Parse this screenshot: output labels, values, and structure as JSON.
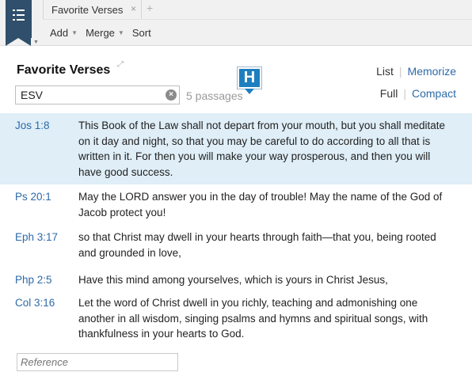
{
  "app": {
    "tab_title": "Favorite Verses",
    "tab_close": "×",
    "tab_add": "+"
  },
  "toolbar": {
    "add_label": "Add",
    "merge_label": "Merge",
    "sort_label": "Sort",
    "caret": "▼"
  },
  "header": {
    "title": "Favorite Verses",
    "resize_glyph": "⤢",
    "list_label": "List",
    "memorize_label": "Memorize",
    "full_label": "Full",
    "compact_label": "Compact",
    "separator": "|"
  },
  "filter": {
    "version_value": "ESV",
    "clear_glyph": "×",
    "passage_count": "5 passages"
  },
  "badge": {
    "letter": "H",
    "color": "#1d7fc0"
  },
  "verses": [
    {
      "ref": "Jos 1:8",
      "text": "This Book of the Law shall not depart from your mouth, but you shall meditate on it day and night, so that you may be careful to do according to all that is written in it. For then you will make your way prosperous, and then you will have good success."
    },
    {
      "ref": "Ps 20:1",
      "text": "May the LORD answer you in the day of trouble! May the name of the God of Jacob protect you!"
    },
    {
      "ref": "Eph 3:17",
      "text": "so that Christ may dwell in your hearts through faith—that you, being rooted and grounded in love,"
    },
    {
      "ref": "Php 2:5",
      "text": "Have this mind among yourselves, which is yours in Christ Jesus,"
    },
    {
      "ref": "Col 3:16",
      "text": "Let the word of Christ dwell in you richly, teaching and admonishing one another in all wisdom, singing psalms and hymns and spiritual songs, with thankfulness in your hearts to God."
    }
  ],
  "reference_input": {
    "placeholder": "Reference",
    "value": ""
  },
  "colors": {
    "accent": "#2e6aa8",
    "selected_row": "#dfeef7",
    "logo": "#2f4f6c"
  }
}
